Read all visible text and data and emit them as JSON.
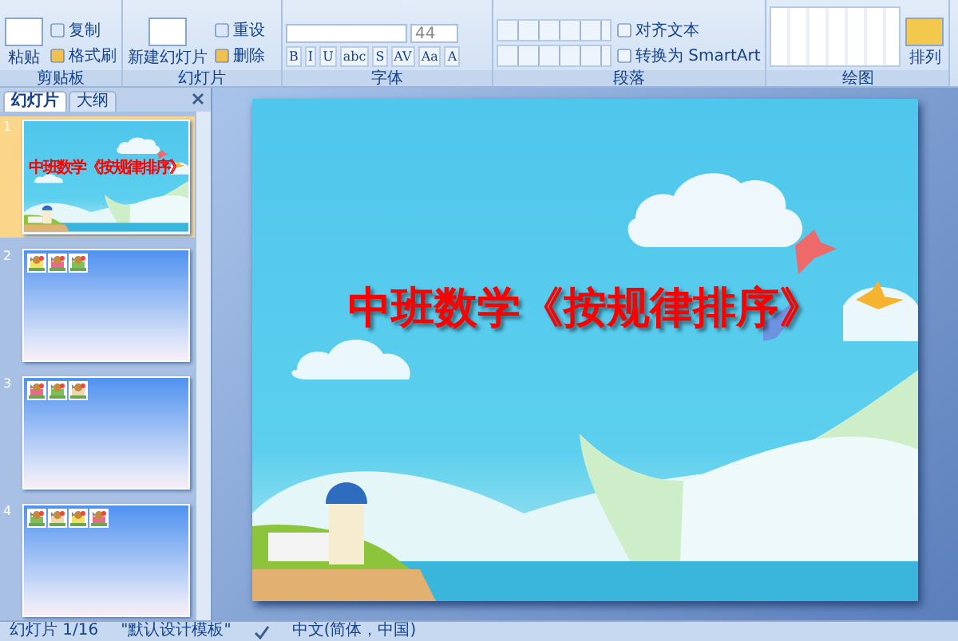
{
  "ribbon": {
    "groups": [
      {
        "kind": "clipboard",
        "label": "剪贴板",
        "big": "粘贴",
        "small": [
          "复制",
          "格式刷"
        ]
      },
      {
        "kind": "slides",
        "label": "幻灯片",
        "big": "新建幻灯片",
        "small": [
          "重设",
          "删除"
        ]
      },
      {
        "kind": "font",
        "label": "字体",
        "size": "44",
        "buttons": [
          "B",
          "I",
          "U",
          "abc",
          "S",
          "AV",
          "Aa",
          "A"
        ]
      },
      {
        "kind": "paragraph",
        "label": "段落",
        "small": [
          "对齐文本",
          "转换为 SmartArt"
        ]
      },
      {
        "kind": "drawing",
        "label": "绘图",
        "big": "排列"
      }
    ]
  },
  "panel": {
    "tabs": [
      {
        "label": "幻灯片",
        "selected": true
      },
      {
        "label": "大纲",
        "selected": false
      }
    ],
    "slides": [
      {
        "number": "1",
        "selected": true,
        "kind": "title",
        "title": "中班数学《按规律排序》"
      },
      {
        "number": "2",
        "selected": false,
        "kind": "images"
      },
      {
        "number": "3",
        "selected": false,
        "kind": "images"
      },
      {
        "number": "4",
        "selected": false,
        "kind": "images"
      }
    ]
  },
  "slide": {
    "title": "中班数学《按规律排序》"
  },
  "status_bar": [
    "幻灯片 1/16",
    "\"默认设计模板\"",
    "中文(简体，中国)"
  ]
}
